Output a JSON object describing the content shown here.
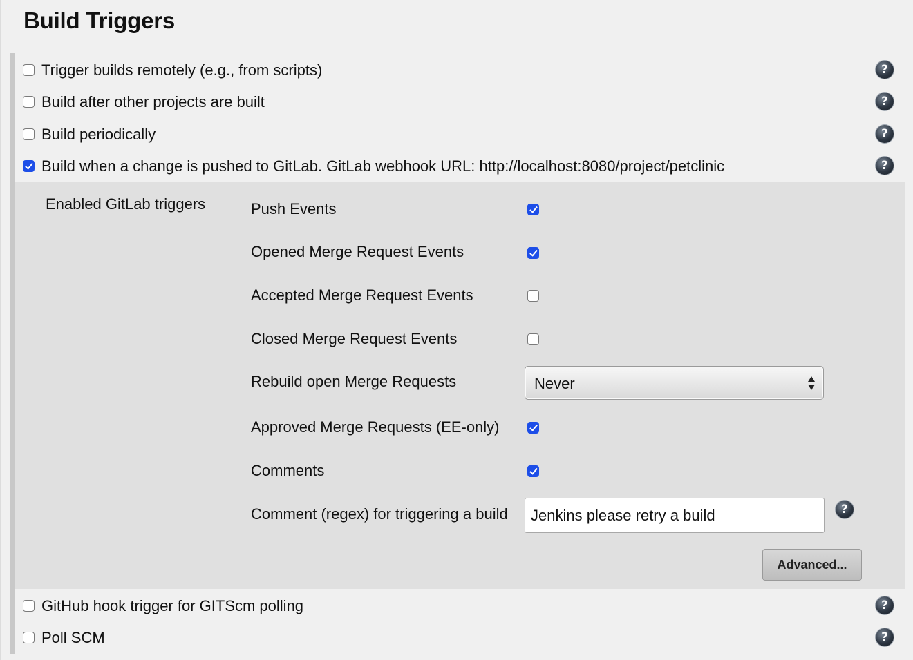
{
  "section": {
    "title": "Build Triggers"
  },
  "triggers": [
    {
      "label": "Trigger builds remotely (e.g., from scripts)",
      "checked": false,
      "help_icon": "help-icon"
    },
    {
      "label": "Build after other projects are built",
      "checked": false,
      "help_icon": "help-icon"
    },
    {
      "label": "Build periodically",
      "checked": false,
      "help_icon": "help-icon"
    },
    {
      "label": "Build when a change is pushed to GitLab. GitLab webhook URL: http://localhost:8080/project/petclinic",
      "checked": true,
      "help_icon": "help-icon"
    },
    {
      "label": "GitHub hook trigger for GITScm polling",
      "checked": false,
      "help_icon": "help-icon"
    },
    {
      "label": "Poll SCM",
      "checked": false,
      "help_icon": "help-icon"
    }
  ],
  "gitlab": {
    "title": "Enabled GitLab triggers",
    "options": [
      {
        "label": "Push Events",
        "checked": true
      },
      {
        "label": "Opened Merge Request Events",
        "checked": true
      },
      {
        "label": "Accepted Merge Request Events",
        "checked": false
      },
      {
        "label": "Closed Merge Request Events",
        "checked": false
      },
      {
        "label": "Approved Merge Requests (EE-only)",
        "checked": true
      },
      {
        "label": "Comments",
        "checked": true
      }
    ],
    "rebuild": {
      "label": "Rebuild open Merge Requests",
      "value": "Never"
    },
    "comment_regex": {
      "label": "Comment (regex) for triggering a build",
      "value": "Jenkins please retry a build"
    },
    "advanced_label": "Advanced..."
  },
  "help_glyph": "?",
  "colors": {
    "page_bg": "#f0f0f0",
    "subpanel_bg": "#e0e0e0",
    "checkbox_checked": "#1d4ee8"
  }
}
